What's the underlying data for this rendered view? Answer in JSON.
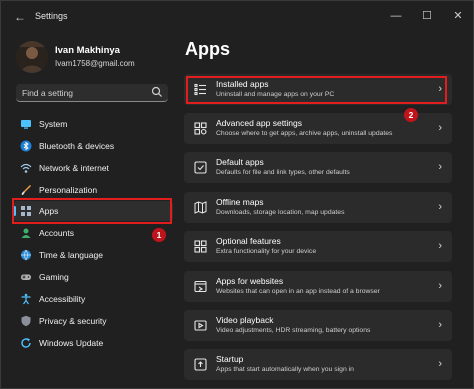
{
  "titlebar": {
    "title": "Settings",
    "back_glyph": "←",
    "minimize_glyph": "—",
    "maximize_glyph": "☐",
    "close_glyph": "✕"
  },
  "user": {
    "name": "Ivan Makhinya",
    "email": "Ivam1758@gmail.com"
  },
  "search": {
    "placeholder": "Find a setting",
    "icon": "search-icon"
  },
  "sidebar": {
    "items": [
      {
        "label": "System",
        "icon": "system-icon"
      },
      {
        "label": "Bluetooth & devices",
        "icon": "bluetooth-icon"
      },
      {
        "label": "Network & internet",
        "icon": "network-icon"
      },
      {
        "label": "Personalization",
        "icon": "brush-icon"
      },
      {
        "label": "Apps",
        "icon": "apps-icon",
        "active": true
      },
      {
        "label": "Accounts",
        "icon": "accounts-icon"
      },
      {
        "label": "Time & language",
        "icon": "globe-clock-icon"
      },
      {
        "label": "Gaming",
        "icon": "gaming-icon"
      },
      {
        "label": "Accessibility",
        "icon": "accessibility-icon"
      },
      {
        "label": "Privacy & security",
        "icon": "shield-icon"
      },
      {
        "label": "Windows Update",
        "icon": "update-icon"
      }
    ]
  },
  "main": {
    "title": "Apps",
    "cards": [
      {
        "title": "Installed apps",
        "desc": "Uninstall and manage apps on your PC",
        "icon": "list-icon"
      },
      {
        "title": "Advanced app settings",
        "desc": "Choose where to get apps, archive apps, uninstall updates",
        "icon": "advanced-apps-icon"
      },
      {
        "title": "Default apps",
        "desc": "Defaults for file and link types, other defaults",
        "icon": "default-apps-icon"
      },
      {
        "title": "Offline maps",
        "desc": "Downloads, storage location, map updates",
        "icon": "map-icon"
      },
      {
        "title": "Optional features",
        "desc": "Extra functionality for your device",
        "icon": "features-icon"
      },
      {
        "title": "Apps for websites",
        "desc": "Websites that can open in an app instead of a browser",
        "icon": "web-apps-icon"
      },
      {
        "title": "Video playback",
        "desc": "Video adjustments, HDR streaming, battery options",
        "icon": "video-icon"
      },
      {
        "title": "Startup",
        "desc": "Apps that start automatically when you sign in",
        "icon": "startup-icon"
      }
    ],
    "chevron": "›"
  },
  "annotations": {
    "badge1": "1",
    "badge2": "2",
    "highlight_color": "#e21d1d"
  },
  "colors": {
    "accent": "#4cc2ff",
    "background": "#202020",
    "card": "#2b2b2b"
  }
}
